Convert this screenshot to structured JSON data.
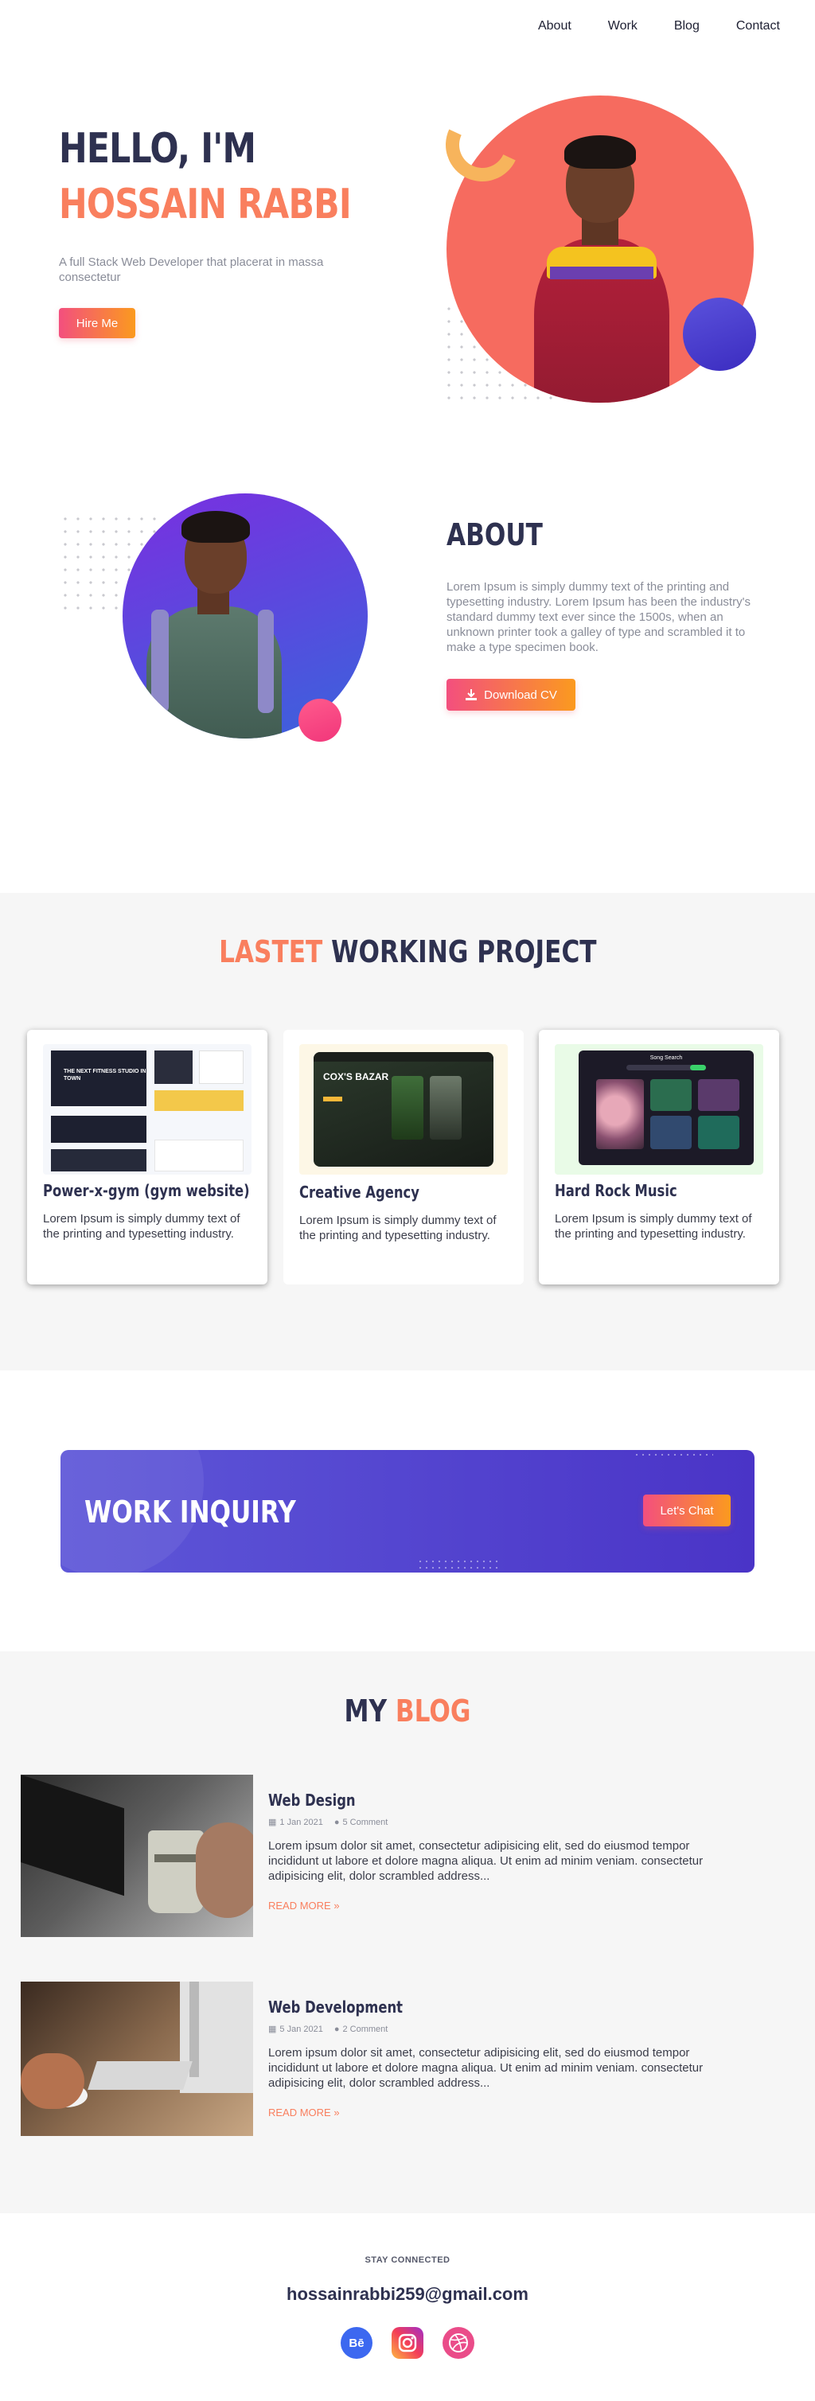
{
  "nav": {
    "items": [
      {
        "label": "About"
      },
      {
        "label": "Work"
      },
      {
        "label": "Blog"
      },
      {
        "label": "Contact"
      }
    ]
  },
  "hero": {
    "greeting": "HELLO, I'M",
    "name": "HOSSAIN RABBI",
    "subtitle": "A full Stack Web Developer that placerat in massa consectetur",
    "button_label": "Hire Me"
  },
  "about": {
    "title": "ABOUT",
    "text": "Lorem Ipsum is simply dummy text of the printing and typesetting industry. Lorem Ipsum has been the industry's standard dummy text ever since the 1500s, when an unknown printer took a galley of type and scrambled it to make a type specimen book.",
    "button_label": "Download CV"
  },
  "projects": {
    "title_accent": "LASTET",
    "title_rest": "WORKING PROJECT",
    "items": [
      {
        "title": "Power-x-gym (gym website)",
        "text": "Lorem Ipsum is simply dummy text of the printing and typesetting industry.",
        "thumb_text": "THE NEXT FITNESS STUDIO IN TOWN"
      },
      {
        "title": "Creative Agency",
        "text": "Lorem Ipsum is simply dummy text of the printing and typesetting industry.",
        "thumb_text": "COX'S BAZAR"
      },
      {
        "title": "Hard Rock Music",
        "text": "Lorem Ipsum is simply dummy text of the printing and typesetting industry.",
        "thumb_text": "Song Search"
      }
    ]
  },
  "inquiry": {
    "title": "WORK INQUIRY",
    "button_label": "Let's Chat"
  },
  "blog": {
    "title_dark": "MY",
    "title_accent": "BLOG",
    "posts": [
      {
        "title": "Web Design",
        "date": "1 Jan 2021",
        "comments": "5 Comment",
        "text": "Lorem ipsum dolor sit amet, consectetur adipisicing elit, sed do eiusmod tempor incididunt ut labore et dolore magna aliqua. Ut enim ad minim veniam. consectetur adipisicing elit, dolor scrambled address...",
        "read_more": "READ MORE"
      },
      {
        "title": "Web Development",
        "date": "5 Jan 2021",
        "comments": "2 Comment",
        "text": "Lorem ipsum dolor sit amet, consectetur adipisicing elit, sed do eiusmod tempor incididunt ut labore et dolore magna aliqua. Ut enim ad minim veniam. consectetur adipisicing elit, dolor scrambled address...",
        "read_more": "READ MORE"
      }
    ]
  },
  "footer": {
    "stay_connected": "STAY CONNECTED",
    "email": "hossainrabbi259@gmail.com",
    "socials": [
      {
        "name": "behance-icon",
        "glyph": "Bē"
      },
      {
        "name": "instagram-icon",
        "glyph": ""
      },
      {
        "name": "dribbble-icon",
        "glyph": ""
      }
    ]
  },
  "colors": {
    "accent": "#f97f5e",
    "navy": "#2e3150",
    "gradient_start": "#f34f7e",
    "gradient_end": "#fb9a1f",
    "purple": "#4a34c7"
  }
}
